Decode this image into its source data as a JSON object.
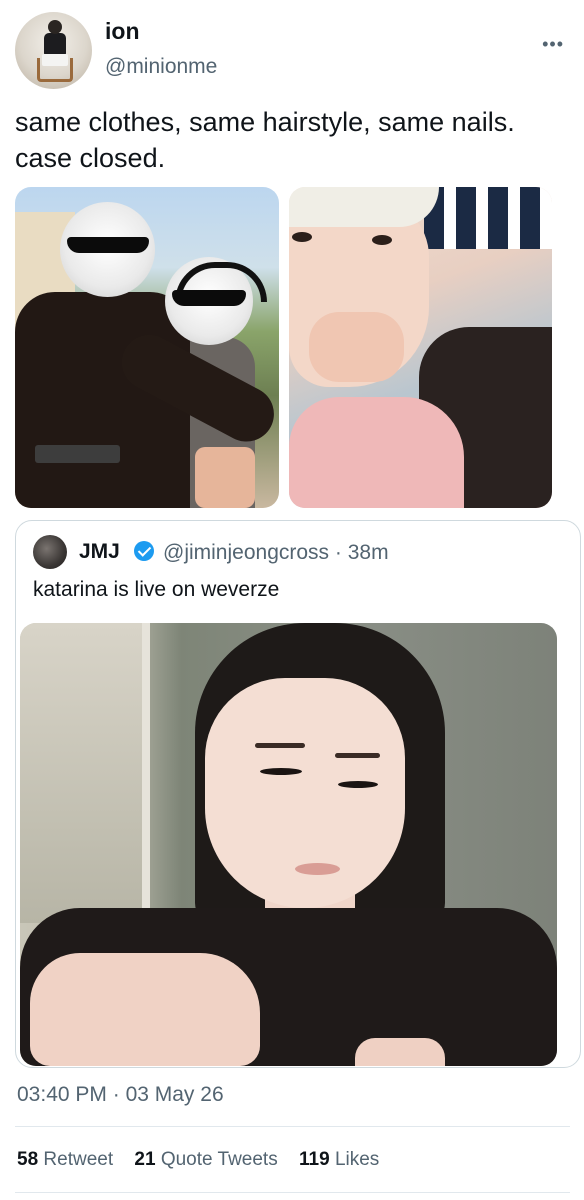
{
  "author": {
    "name": "ion",
    "handle": "@minionme"
  },
  "more_icon": "more-horizontal-icon",
  "more_glyph": "•••",
  "tweet": {
    "text": "same clothes, same hairstyle, same nails. case closed."
  },
  "quoted": {
    "name": "JMJ",
    "verified": true,
    "handle": "@jiminjeongcross",
    "separator": " · ",
    "time": "38m",
    "text": "katarina is live on weverze"
  },
  "timestamp": {
    "time": "03:40 PM",
    "separator": " · ",
    "date": "03 May 26"
  },
  "stats": {
    "retweets": {
      "count": "58",
      "label": "Retweet"
    },
    "quotes": {
      "count": "21",
      "label": "Quote Tweets"
    },
    "likes": {
      "count": "119",
      "label": "Likes"
    }
  },
  "colors": {
    "secondary_text": "#536471",
    "verified_blue": "#1d9bf0",
    "border": "#cfd9de"
  }
}
